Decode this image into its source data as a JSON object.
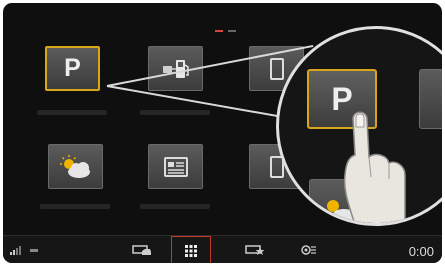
{
  "screen": {
    "tiles": [
      {
        "id": "parking",
        "icon": "parking-icon",
        "letter": "P",
        "selected": true
      },
      {
        "id": "charging",
        "icon": "fuel-charging-icon"
      },
      {
        "id": "apps-3",
        "icon": "app-tile-icon"
      },
      {
        "id": "weather",
        "icon": "weather-icon"
      },
      {
        "id": "news",
        "icon": "news-icon"
      },
      {
        "id": "apps-6",
        "icon": "app-tile-icon"
      }
    ],
    "magnifier": {
      "tile_letter": "P",
      "gesture": "tap-finger-icon"
    }
  },
  "page_indicator": {
    "count": 2,
    "active": 0
  },
  "statusbar": {
    "clock": "0:00",
    "items": [
      "signal-icon",
      "car-icon",
      "home-grid-icon",
      "favorites-icon",
      "settings-icon"
    ]
  },
  "colors": {
    "accent": "#d9a51b",
    "nav_highlight": "#c33a2d",
    "active_dot": "#d8453a"
  }
}
